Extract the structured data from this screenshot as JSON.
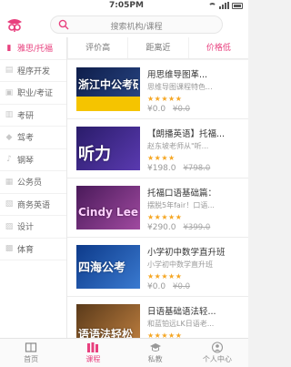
{
  "status": {
    "time": "7:05PM"
  },
  "search": {
    "placeholder": "搜索机构/课程"
  },
  "sidebar": {
    "items": [
      {
        "label": "雅思/托福",
        "icon": "book-icon",
        "active": true
      },
      {
        "label": "程序开发",
        "icon": "code-icon",
        "active": false
      },
      {
        "label": "职业/考证",
        "icon": "certificate-icon",
        "active": false
      },
      {
        "label": "考研",
        "icon": "exam-icon",
        "active": false
      },
      {
        "label": "驾考",
        "icon": "car-icon",
        "active": false
      },
      {
        "label": "钢琴",
        "icon": "piano-icon",
        "active": false
      },
      {
        "label": "公务员",
        "icon": "civil-servant-icon",
        "active": false
      },
      {
        "label": "商务英语",
        "icon": "business-icon",
        "active": false
      },
      {
        "label": "设计",
        "icon": "design-icon",
        "active": false
      },
      {
        "label": "体育",
        "icon": "sports-icon",
        "active": false
      }
    ]
  },
  "sort_tabs": [
    {
      "label": "评价高",
      "active": false
    },
    {
      "label": "距离近",
      "active": false
    },
    {
      "label": "价格低",
      "active": true
    }
  ],
  "courses": [
    {
      "title": "用思维导图革...",
      "subtitle": "思维导图课程特色...",
      "stars": "★★★★★",
      "price": "¥0.0",
      "original": "¥0.0",
      "thumb_text": "浙江中公考研",
      "thumb_color": "#1a2a5a"
    },
    {
      "title": "【朗播英语】托福...",
      "subtitle": "赵东坡老师从\"听...",
      "stars": "★★★★",
      "price": "¥198.0",
      "original": "¥798.0",
      "thumb_text": "听力",
      "thumb_color": "#3a2a7a"
    },
    {
      "title": "托福口语基础篇：",
      "subtitle": "摆脱5年fair！口语...",
      "stars": "★★★★★",
      "price": "¥290.0",
      "original": "¥399.0",
      "thumb_text": "Cindy Lee",
      "thumb_color": "#6a2a7a"
    },
    {
      "title": "小学初中数学直升班",
      "subtitle": "小学初中数学直升班",
      "stars": "★★★★★",
      "price": "¥0.0",
      "original": "¥0.0",
      "thumb_text": "四海公考",
      "thumb_color": "#1a4aa0"
    },
    {
      "title": "日语基础语法轻...",
      "subtitle": "和蓝铂远LK日语老...",
      "stars": "★★★★★",
      "price": "",
      "original": "",
      "thumb_text": "语语法轻松",
      "thumb_color": "#8a4a1a"
    }
  ],
  "bottom_nav": [
    {
      "label": "首页",
      "icon": "home-icon",
      "active": false
    },
    {
      "label": "课程",
      "icon": "courses-icon",
      "active": true
    },
    {
      "label": "私教",
      "icon": "graduation-cap-icon",
      "active": false
    },
    {
      "label": "个人中心",
      "icon": "user-icon",
      "active": false
    }
  ],
  "colors": {
    "accent": "#e8407e"
  }
}
